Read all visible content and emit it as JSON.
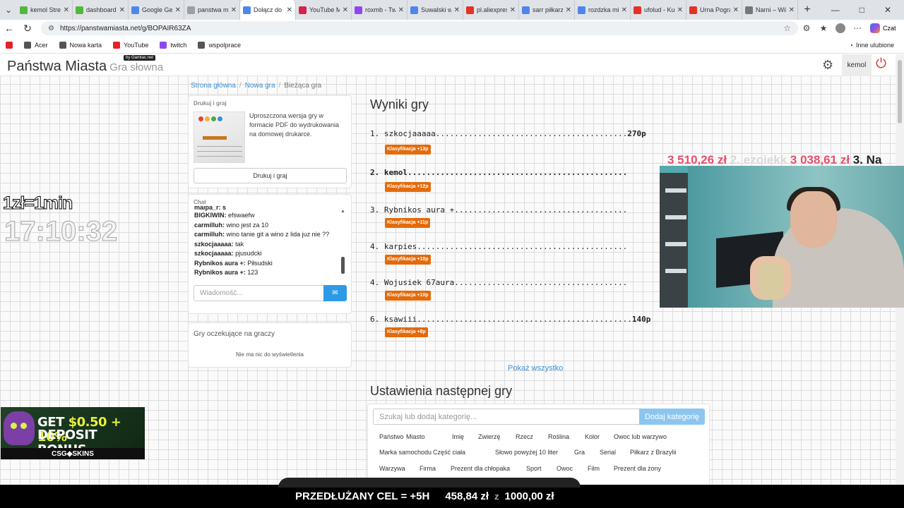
{
  "browser": {
    "tabs": [
      {
        "title": "kemol Strea",
        "color": "#53b83a"
      },
      {
        "title": "dashboard",
        "color": "#53b83a"
      },
      {
        "title": "Google Gem",
        "color": "#4f86ec"
      },
      {
        "title": "panstwa mi",
        "color": "#9aa0a6"
      },
      {
        "title": "Dołącz do g",
        "color": "#4f86ec"
      },
      {
        "title": "YouTube M",
        "color": "#d6224d"
      },
      {
        "title": "roxmb - Tw",
        "color": "#8f46f0"
      },
      {
        "title": "Suwalski wo",
        "color": "#4f86ec"
      },
      {
        "title": "pl.aliexpres",
        "color": "#e43225"
      },
      {
        "title": "sarr piłkarz",
        "color": "#4f86ec"
      },
      {
        "title": "rozdzka mi",
        "color": "#4f86ec"
      },
      {
        "title": "ufolud - Ku",
        "color": "#e43225"
      },
      {
        "title": "Urna Pogra",
        "color": "#e43225"
      },
      {
        "title": "Narni – Wik",
        "color": "#777777"
      }
    ],
    "active_tab": 4,
    "url": "https://panstwamiasta.net/g/BOPAIR63ZA",
    "copilot_label": "Czat",
    "bookmarks": [
      {
        "label": "",
        "color": "#e3222b"
      },
      {
        "label": "Acer",
        "color": "#555555"
      },
      {
        "label": "Nowa karta",
        "color": "#555555"
      },
      {
        "label": "YouTube",
        "color": "#e3222b"
      },
      {
        "label": "twitch",
        "color": "#8f46f0"
      },
      {
        "label": "wspolprace",
        "color": "#555555"
      }
    ],
    "other_bookmarks": "Inne ulubione"
  },
  "site": {
    "logo": "Państwa Miasta",
    "logo_sub": "Gra słowna",
    "logo_badge": "by Gamtac.net",
    "username": "kemol"
  },
  "breadcrumb": {
    "home": "Strona główna",
    "new_game": "Nowa gra",
    "current": "Bieżąca gra"
  },
  "print_panel": {
    "title": "Drukuj i graj",
    "description": "Uproszczona wersja gry w formacie PDF do wydrukowania na domowej drukarce.",
    "button": "Drukuj i graj"
  },
  "chat": {
    "title": "Chat",
    "partial_top": "malpa_r: s",
    "messages": [
      {
        "user": "BIGKIWIN:",
        "text": "efswaefw"
      },
      {
        "user": "carmilluh:",
        "text": "wino jest za 10"
      },
      {
        "user": "carmilluh:",
        "text": "wino tanie git a wino z lida juz nie ??"
      },
      {
        "user": "szkocjaaaaa:",
        "text": "tak"
      },
      {
        "user": "szkocjaaaaa:",
        "text": "pjusudcki"
      },
      {
        "user": "Rybnikos aura +:",
        "text": "Piłsudski"
      },
      {
        "user": "Rybnikos aura +:",
        "text": "123"
      }
    ],
    "placeholder": "Wiadomość..."
  },
  "waiting": {
    "title": "Gry oczekujące na graczy",
    "empty": "Nie ma nic do wyświetlenia"
  },
  "results": {
    "title": "Wyniki gry",
    "rows": [
      {
        "text": "1. szkocjaaaaa.........................................",
        "points": "270p",
        "badge": "Klasyfikacja +13p"
      },
      {
        "text": "2. kemol...............................................",
        "points": "",
        "badge": "Klasyfikacja +12p"
      },
      {
        "text": "3. Rybnikos aura +.....................................",
        "points": "",
        "badge": "Klasyfikacja +11p"
      },
      {
        "text": "4. karpies.............................................",
        "points": "",
        "badge": "Klasyfikacja +10p"
      },
      {
        "text": "4. Wojusiek 67aura.....................................",
        "points": "",
        "badge": "Klasyfikacja +10p"
      },
      {
        "text": "6. ksawiii..............................................",
        "points": "140p",
        "badge": "Klasyfikacja +8p"
      }
    ],
    "show_all": "Pokaż wszystko"
  },
  "settings": {
    "title": "Ustawienia następnej gry",
    "placeholder": "Szukaj lub dodaj kategorię...",
    "add_button": "Dodaj kategorię",
    "categories": [
      [
        "Państwo",
        "Miasto",
        "Imię",
        "Zwierzę",
        "Rzecz",
        "Roślina",
        "Kolor",
        "Owoc lub warzywo"
      ],
      [
        "Marka samochodu",
        "Część ciała",
        "Słowo powyżej 10 liter",
        "Gra",
        "Serial",
        "Piłkarz z Brazylii"
      ],
      [
        "Warzywa",
        "Firma",
        "Prezent dla chłopaka",
        "Sport",
        "Owoc",
        "Film",
        "Prezent dla żony"
      ]
    ]
  },
  "overlay": {
    "rate": "1zł=1min",
    "clock": "17:10:32",
    "ticker_a": "3 510,26 zł",
    "ticker_b": "2. ezoiekk",
    "ticker_c": "3 038,61 zł",
    "ticker_d": "3. Na",
    "ad_line1_a": "GET ",
    "ad_line1_b": "$0.50 + 10%",
    "ad_line2": "DEPOSIT BONUS",
    "ad_brand": "CSG◆SKINS",
    "goal_label": "PRZEDŁUŻANY CEL = +5H",
    "goal_current": "458,84 zł",
    "goal_of": "z",
    "goal_target": "1000,00 zł"
  }
}
